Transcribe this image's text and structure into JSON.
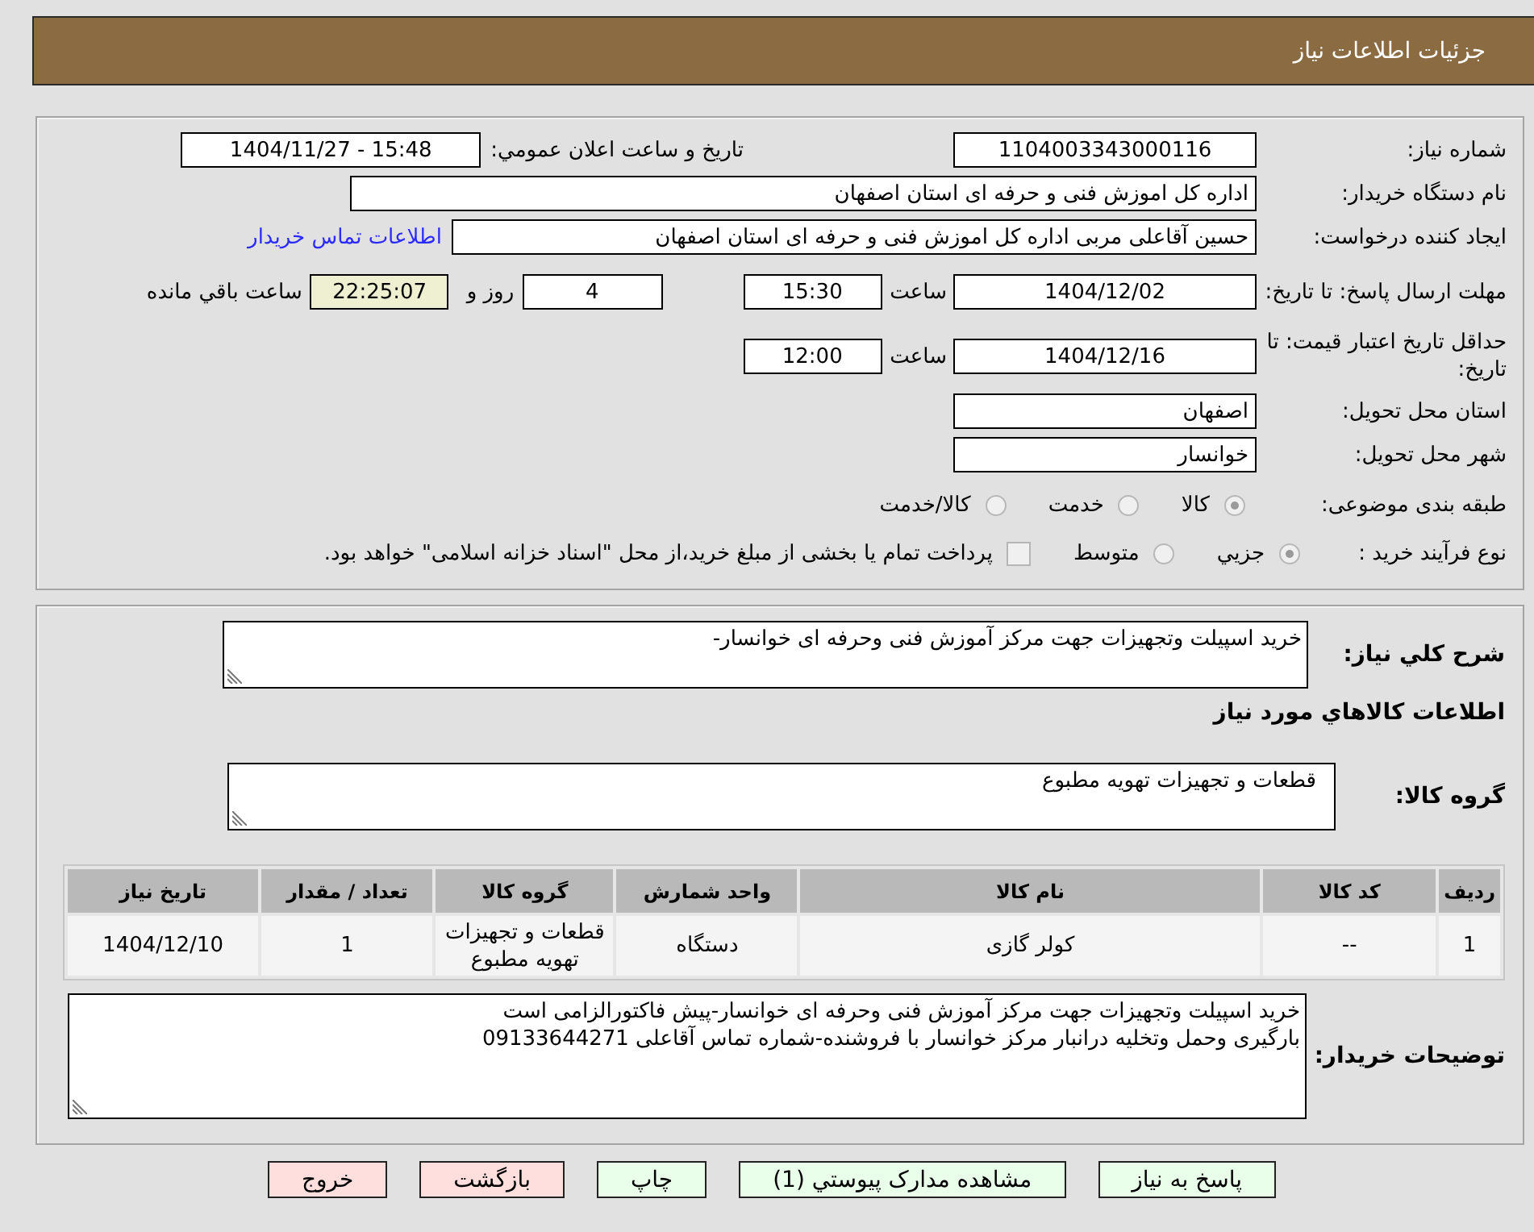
{
  "header": {
    "title": "جزئیات اطلاعات نیاز"
  },
  "details": {
    "need_number": {
      "label": "شماره نیاز:",
      "value": "1104003343000116"
    },
    "announce_datetime": {
      "label": "تاریخ و ساعت اعلان عمومي:",
      "value": "1404/11/27 - 15:48"
    },
    "buyer_org": {
      "label": "نام دستگاه خریدار:",
      "value": "اداره کل اموزش فنی و حرفه ای استان اصفهان"
    },
    "requester": {
      "label": "ایجاد کننده درخواست:",
      "value": "حسین آقاعلی مربی اداره کل اموزش فنی و حرفه ای استان اصفهان",
      "link": "اطلاعات تماس خریدار"
    },
    "reply_deadline": {
      "label": "مهلت ارسال پاسخ: تا تاریخ:",
      "date": "1404/12/02",
      "time_label": "ساعت",
      "time": "15:30",
      "days": "4",
      "days_label": "روز و",
      "remaining": "22:25:07",
      "remaining_label": "ساعت باقي مانده"
    },
    "price_validity": {
      "label": "حداقل تاریخ اعتبار قیمت: تا تاریخ:",
      "date": "1404/12/16",
      "time_label": "ساعت",
      "time": "12:00"
    },
    "delivery_province": {
      "label": "استان محل تحویل:",
      "value": "اصفهان"
    },
    "delivery_city": {
      "label": "شهر محل تحویل:",
      "value": "خوانسار"
    },
    "subject_category": {
      "label": "طبقه بندی موضوعی:",
      "options": [
        {
          "label": "کالا",
          "selected": true
        },
        {
          "label": "خدمت",
          "selected": false
        },
        {
          "label": "کالا/خدمت",
          "selected": false
        }
      ]
    },
    "purchase_process": {
      "label": "نوع فرآیند خرید :",
      "options": [
        {
          "label": "جزيي",
          "selected": true
        },
        {
          "label": "متوسط",
          "selected": false
        }
      ],
      "treasury": {
        "label": "پرداخت تمام یا بخشی از مبلغ خرید،از محل \"اسناد خزانه اسلامی\" خواهد بود.",
        "checked": false
      }
    }
  },
  "summary": {
    "description": {
      "label": "شرح کلي نیاز:",
      "value": "خرید اسپیلت وتجهیزات جهت مرکز آموزش فنی وحرفه ای خوانسار-"
    },
    "goods_heading": "اطلاعات کالاهاي مورد نیاز",
    "goods_group": {
      "label": "گروه کالا:",
      "value": "قطعات و تجهیزات تهویه مطبوع"
    },
    "table": {
      "columns": [
        "ردیف",
        "کد کالا",
        "نام کالا",
        "واحد شمارش",
        "گروه کالا",
        "تعداد / مقدار",
        "تاریخ نیاز"
      ],
      "rows": [
        [
          "1",
          "--",
          "کولر گازی",
          "دستگاه",
          "قطعات و تجهیزات تهویه مطبوع",
          "1",
          "1404/12/10"
        ]
      ]
    },
    "buyer_notes": {
      "label": "توضیحات خریدار:",
      "value": "خرید اسپیلت وتجهیزات جهت مرکز آموزش فنی وحرفه ای خوانسار-پیش فاکتورالزامی است\nبارگیری وحمل وتخلیه درانبار مرکز خوانسار با فروشنده-شماره تماس آقاعلی 09133644271"
    }
  },
  "buttons": [
    {
      "label": "پاسخ به نیاز",
      "color": "#eaffea"
    },
    {
      "label": "مشاهده مدارک پیوستي (1)",
      "color": "#eaffea"
    },
    {
      "label": "چاپ",
      "color": "#eaffea"
    },
    {
      "label": "بازگشت",
      "color": "#ffdede"
    },
    {
      "label": "خروج",
      "color": "#ffdede"
    }
  ]
}
